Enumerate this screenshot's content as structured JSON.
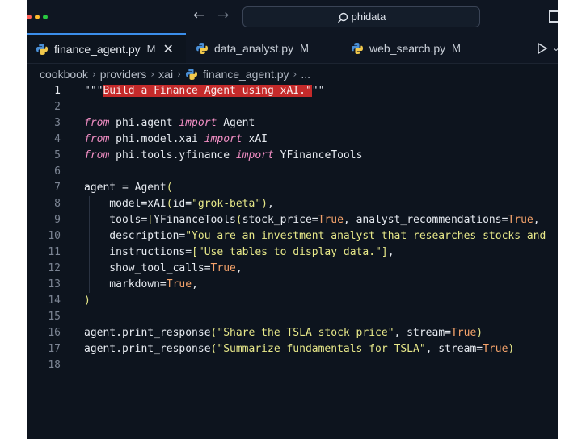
{
  "titlebar": {
    "search_text": "phidata",
    "back_icon": "arrow-left-icon",
    "forward_icon": "arrow-right-icon"
  },
  "tabs": [
    {
      "label": "finance_agent.py",
      "status": "M",
      "active": true
    },
    {
      "label": "data_analyst.py",
      "status": "M",
      "active": false
    },
    {
      "label": "web_search.py",
      "status": "M",
      "active": false
    }
  ],
  "breadcrumb": {
    "items": [
      "cookbook",
      "providers",
      "xai",
      "finance_agent.py"
    ],
    "more": "..."
  },
  "editor": {
    "current_line": 1,
    "lines": [
      {
        "n": "1",
        "segs": [
          {
            "t": "\"\"\"",
            "c": ""
          },
          {
            "t": "Build a Finance Agent using xAI.",
            "c": "hl"
          },
          {
            "t": "\"",
            "c": "hl"
          },
          {
            "t": "\"\"",
            "c": ""
          }
        ]
      },
      {
        "n": "2",
        "segs": []
      },
      {
        "n": "3",
        "segs": [
          {
            "t": "from",
            "c": "kw"
          },
          {
            "t": " phi.agent ",
            "c": ""
          },
          {
            "t": "import",
            "c": "kw"
          },
          {
            "t": " Agent",
            "c": ""
          }
        ]
      },
      {
        "n": "4",
        "segs": [
          {
            "t": "from",
            "c": "kw"
          },
          {
            "t": " phi.model.xai ",
            "c": ""
          },
          {
            "t": "import",
            "c": "kw"
          },
          {
            "t": " xAI",
            "c": ""
          }
        ]
      },
      {
        "n": "5",
        "segs": [
          {
            "t": "from",
            "c": "kw"
          },
          {
            "t": " phi.tools.yfinance ",
            "c": ""
          },
          {
            "t": "import",
            "c": "kw"
          },
          {
            "t": " YFinanceTools",
            "c": ""
          }
        ]
      },
      {
        "n": "6",
        "segs": []
      },
      {
        "n": "7",
        "segs": [
          {
            "t": "agent = Agent",
            "c": ""
          },
          {
            "t": "(",
            "c": "par"
          }
        ]
      },
      {
        "n": "8",
        "segs": [
          {
            "t": "    model=xAI",
            "c": ""
          },
          {
            "t": "(",
            "c": "par"
          },
          {
            "t": "id=",
            "c": ""
          },
          {
            "t": "\"grok-beta\"",
            "c": "str"
          },
          {
            "t": ")",
            "c": "par"
          },
          {
            "t": ",",
            "c": ""
          }
        ]
      },
      {
        "n": "9",
        "segs": [
          {
            "t": "    tools=",
            "c": ""
          },
          {
            "t": "[",
            "c": "par"
          },
          {
            "t": "YFinanceTools",
            "c": ""
          },
          {
            "t": "(",
            "c": "par"
          },
          {
            "t": "stock_price=",
            "c": ""
          },
          {
            "t": "True",
            "c": "bool"
          },
          {
            "t": ", analyst_recommendations=",
            "c": ""
          },
          {
            "t": "True",
            "c": "bool"
          },
          {
            "t": ",",
            "c": ""
          }
        ]
      },
      {
        "n": "10",
        "segs": [
          {
            "t": "    description=",
            "c": ""
          },
          {
            "t": "\"You are an investment analyst that researches stocks and",
            "c": "str"
          }
        ]
      },
      {
        "n": "11",
        "segs": [
          {
            "t": "    instructions=",
            "c": ""
          },
          {
            "t": "[",
            "c": "par"
          },
          {
            "t": "\"Use tables to display data.\"",
            "c": "str"
          },
          {
            "t": "]",
            "c": "par"
          },
          {
            "t": ",",
            "c": ""
          }
        ]
      },
      {
        "n": "12",
        "segs": [
          {
            "t": "    show_tool_calls=",
            "c": ""
          },
          {
            "t": "True",
            "c": "bool"
          },
          {
            "t": ",",
            "c": ""
          }
        ]
      },
      {
        "n": "13",
        "segs": [
          {
            "t": "    markdown=",
            "c": ""
          },
          {
            "t": "True",
            "c": "bool"
          },
          {
            "t": ",",
            "c": ""
          }
        ]
      },
      {
        "n": "14",
        "segs": [
          {
            "t": ")",
            "c": "par"
          }
        ]
      },
      {
        "n": "15",
        "segs": []
      },
      {
        "n": "16",
        "segs": [
          {
            "t": "agent.print_response",
            "c": ""
          },
          {
            "t": "(",
            "c": "par"
          },
          {
            "t": "\"Share the TSLA stock price\"",
            "c": "str"
          },
          {
            "t": ", stream=",
            "c": ""
          },
          {
            "t": "True",
            "c": "bool"
          },
          {
            "t": ")",
            "c": "par"
          }
        ]
      },
      {
        "n": "17",
        "segs": [
          {
            "t": "agent.print_response",
            "c": ""
          },
          {
            "t": "(",
            "c": "par"
          },
          {
            "t": "\"Summarize fundamentals for TSLA\"",
            "c": "str"
          },
          {
            "t": ", stream=",
            "c": ""
          },
          {
            "t": "True",
            "c": "bool"
          },
          {
            "t": ")",
            "c": "par"
          }
        ]
      },
      {
        "n": "18",
        "segs": []
      }
    ]
  },
  "colors": {
    "background": "#0d141e",
    "accent": "#3b8eea",
    "keyword": "#f38fc5",
    "string": "#e7e889",
    "boolean": "#f5a36b",
    "selection": "#c42a2a"
  }
}
